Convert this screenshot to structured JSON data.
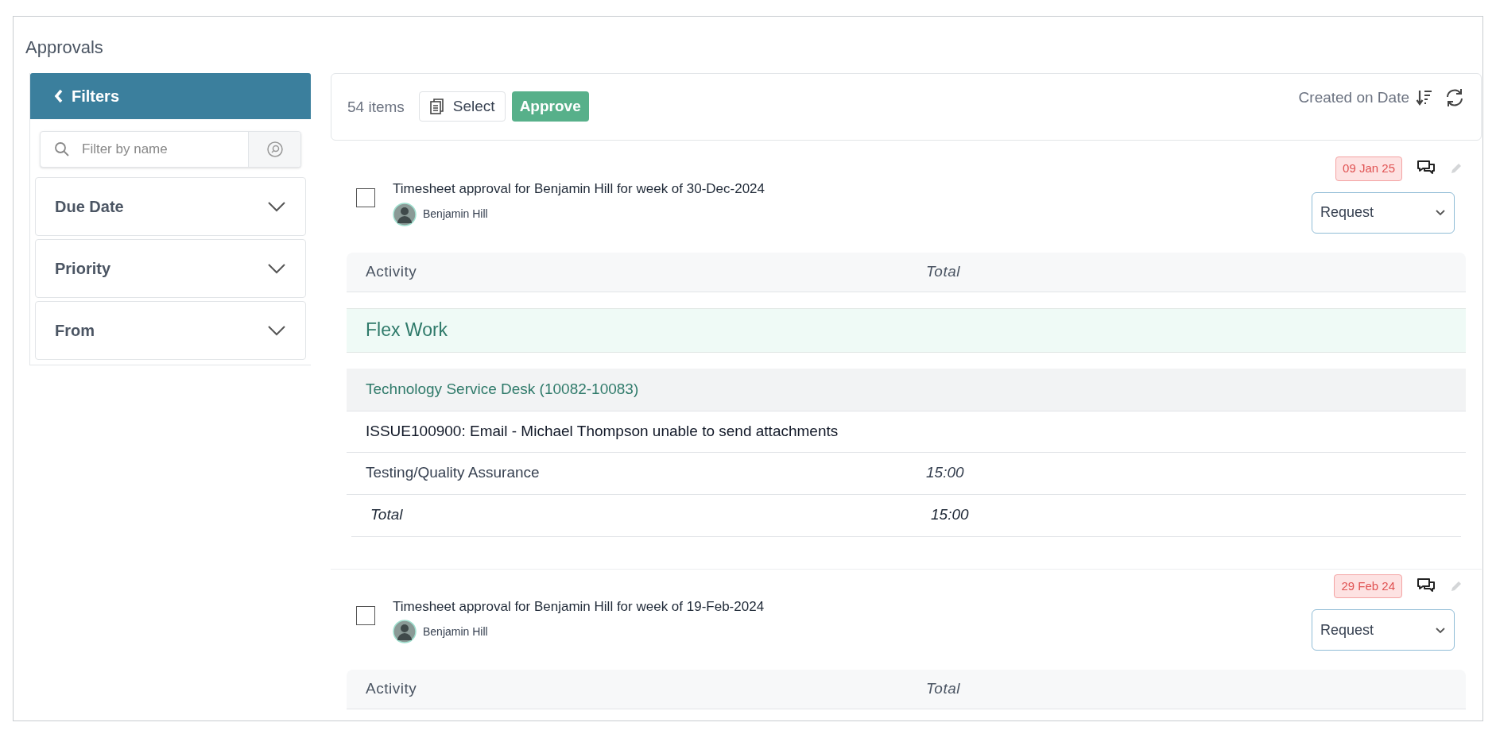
{
  "page": {
    "title": "Approvals"
  },
  "filters": {
    "title": "Filters",
    "search": {
      "placeholder": "Filter by name"
    },
    "sections": [
      {
        "label": "Due Date",
        "expanded": false
      },
      {
        "label": "Priority",
        "expanded": false
      },
      {
        "label": "From",
        "expanded": false
      }
    ]
  },
  "toolbar": {
    "count": "54 items",
    "select_button": "Select",
    "approve_button": "Approve",
    "sort_label": "Created on Date"
  },
  "approvals": [
    {
      "title": "Timesheet approval for Benjamin Hill for week of 30-Dec-2024",
      "checked": false,
      "requester": "Benjamin Hill",
      "due_badge": "09 Jan 25",
      "status": "Request",
      "table": {
        "columns": [
          "Activity",
          "Total"
        ],
        "rows": [
          {
            "kind": "category",
            "cells": [
              "Flex Work"
            ]
          },
          {
            "kind": "project",
            "cells": [
              "Technology Service Desk (10082-10083)"
            ]
          },
          {
            "kind": "item",
            "cells": [
              "ISSUE100900: Email - Michael Thompson unable to send attachments"
            ]
          },
          {
            "kind": "activity",
            "cells": [
              "Testing/Quality Assurance",
              "15:00"
            ]
          },
          {
            "kind": "total",
            "cells": [
              "Total",
              "15:00"
            ]
          }
        ]
      }
    },
    {
      "title": "Timesheet approval for Benjamin Hill for week of 19-Feb-2024",
      "checked": false,
      "requester": "Benjamin Hill",
      "due_badge": "29 Feb 24",
      "status": "Request",
      "table": {
        "columns": [
          "Activity",
          "Total"
        ]
      }
    }
  ]
}
